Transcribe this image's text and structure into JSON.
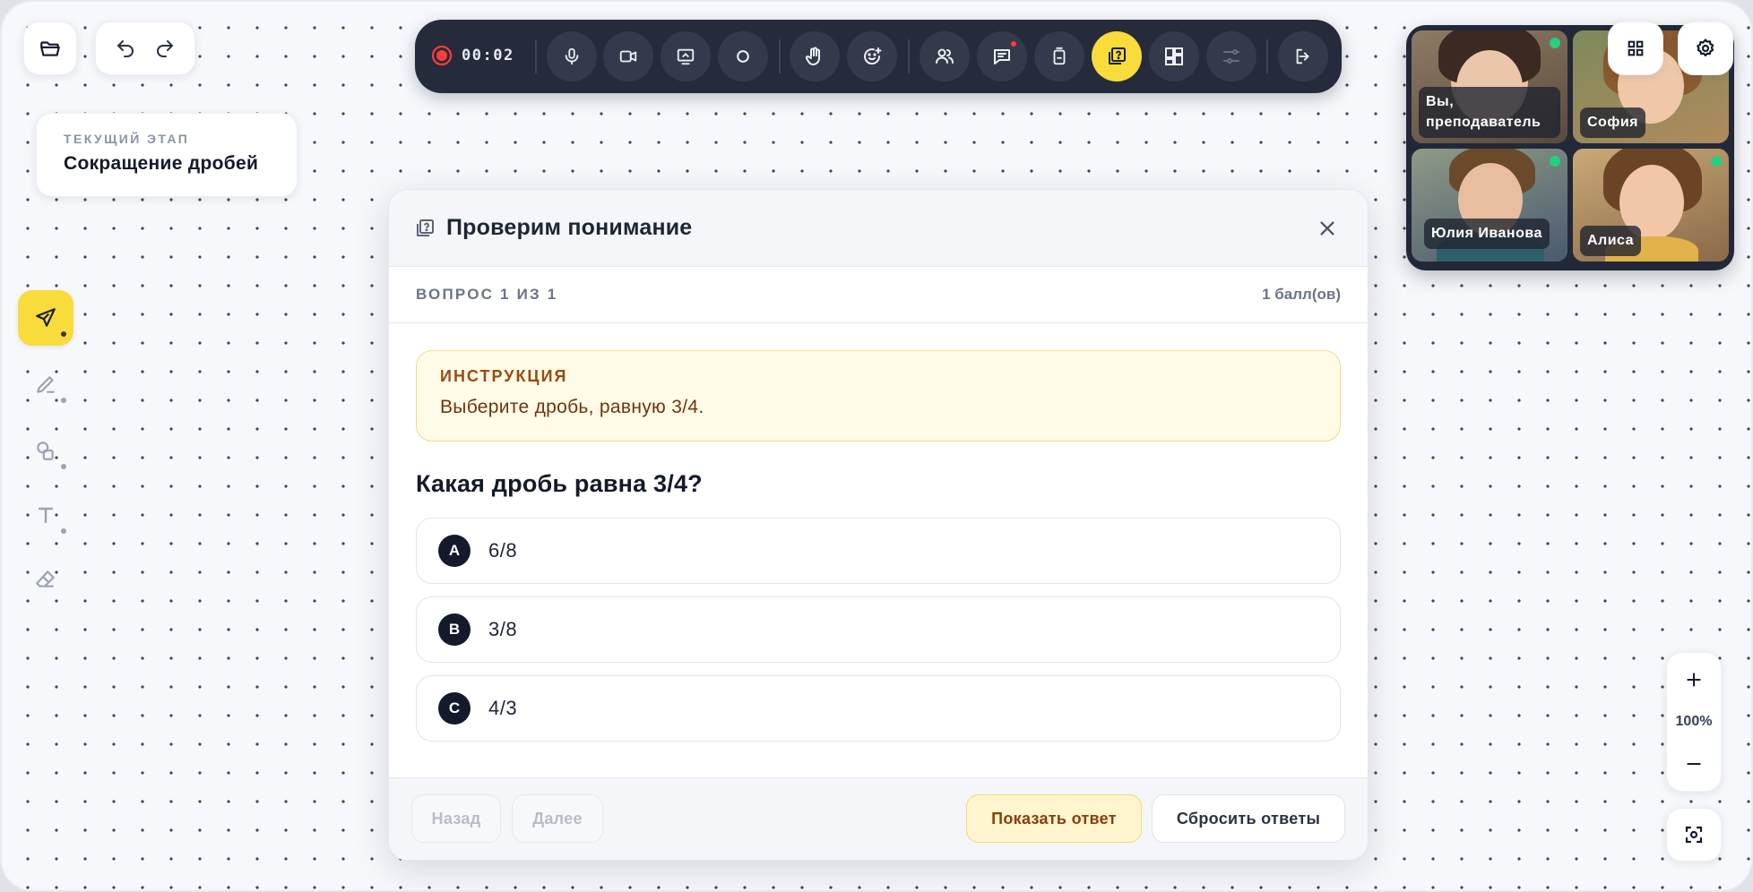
{
  "stage": {
    "label": "ТЕКУЩИЙ ЭТАП",
    "title": "Сокращение дробей"
  },
  "toolbar": {
    "timer": "00:02",
    "record_color": "#ff3b3b",
    "active_color": "#f8dc3c"
  },
  "participants": [
    {
      "name": "Вы, преподаватель",
      "online": true
    },
    {
      "name": "София",
      "online": false
    },
    {
      "name": "Юлия Иванова",
      "online": true
    },
    {
      "name": "Алиса",
      "online": true
    }
  ],
  "zoom": {
    "value": "100%"
  },
  "modal": {
    "title": "Проверим понимание",
    "question_counter": "ВОПРОС 1 ИЗ 1",
    "points": "1 балл(ов)",
    "instruction_label": "ИНСТРУКЦИЯ",
    "instruction_text": "Выберите дробь, равную 3/4.",
    "question": "Какая дробь равна 3/4?",
    "options": [
      {
        "letter": "A",
        "text": "6/8"
      },
      {
        "letter": "B",
        "text": "3/8"
      },
      {
        "letter": "C",
        "text": "4/3"
      }
    ],
    "back_label": "Назад",
    "next_label": "Далее",
    "show_answer_label": "Показать ответ",
    "reset_label": "Сбросить ответы"
  }
}
